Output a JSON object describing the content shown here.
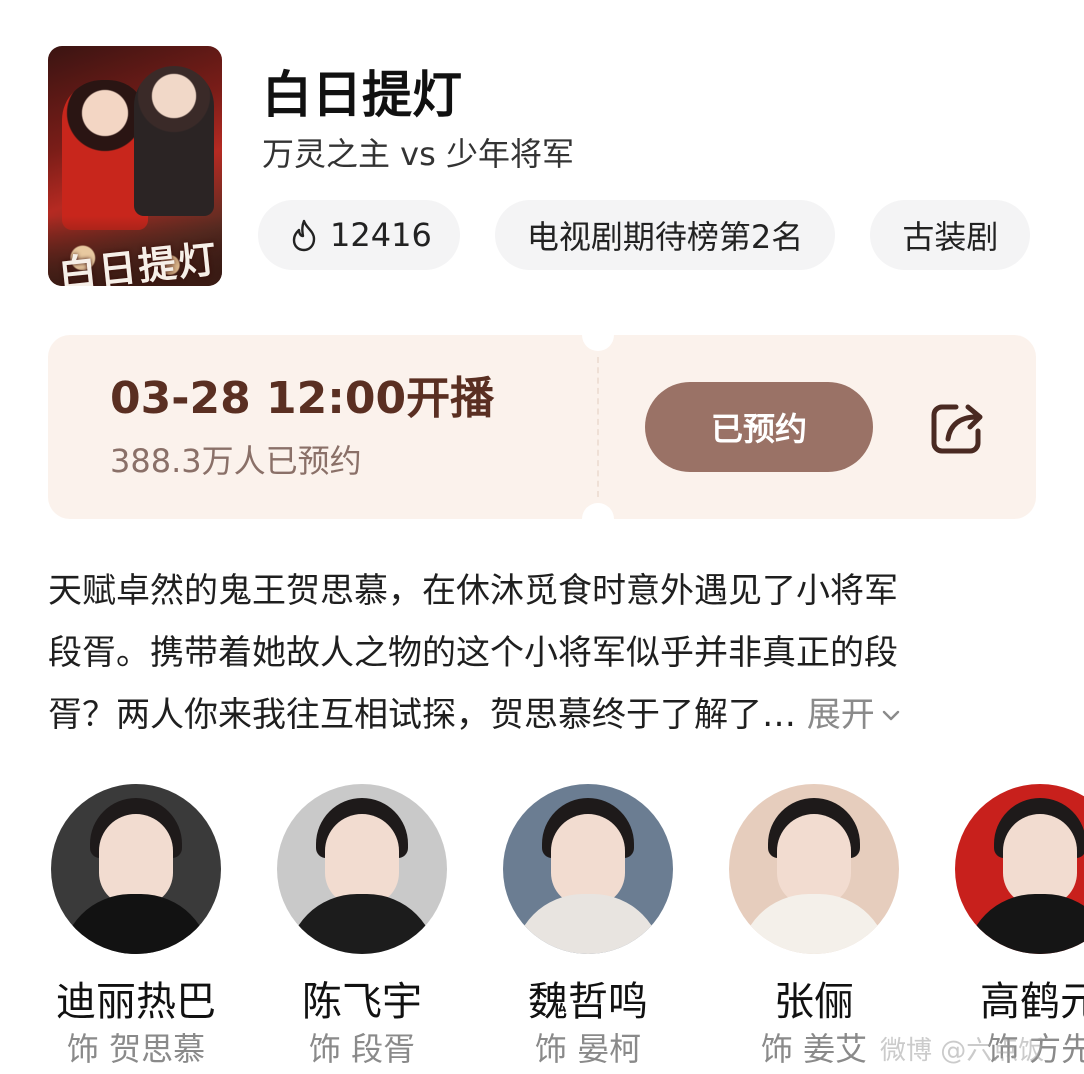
{
  "show": {
    "title": "白日提灯",
    "subtitle": "万灵之主 vs 少年将军",
    "poster_title_art": "白日提灯",
    "chips": [
      {
        "icon": "flame-icon",
        "label": "12416"
      },
      {
        "icon": "",
        "label": "电视剧期待榜第2名"
      },
      {
        "icon": "",
        "label": "古装剧"
      }
    ]
  },
  "schedule": {
    "air_time": "03-28 12:00开播",
    "reservation_count": "388.3万人已预约",
    "reserve_button_label": "已预约",
    "share_icon": "share-icon"
  },
  "synopsis": {
    "lines": [
      "天赋卓然的鬼王贺思慕，在休沐觅食时意外遇见了小将军",
      "段胥。携带着她故人之物的这个小将军似乎并非真正的段",
      "胥？两人你来我往互相试探，贺思慕终于了解了…"
    ],
    "expand_label": "展开"
  },
  "cast": [
    {
      "name": "迪丽热巴",
      "role": "饰 贺思慕"
    },
    {
      "name": "陈飞宇",
      "role": "饰 段胥"
    },
    {
      "name": "魏哲鸣",
      "role": "饰 晏柯"
    },
    {
      "name": "张俪",
      "role": "饰 姜艾"
    },
    {
      "name": "高鹤元",
      "role": "饰 方先"
    }
  ],
  "watermark": "微博 @六点饭",
  "colors": {
    "accent_brown": "#9a7266",
    "ticket_bg": "#fbf2ec",
    "time_text": "#5a2f22"
  }
}
